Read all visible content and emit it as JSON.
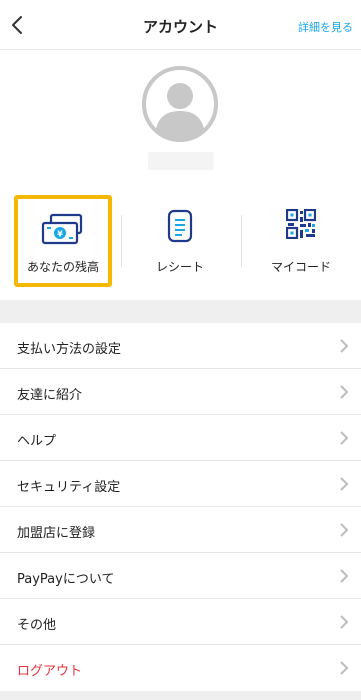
{
  "header": {
    "title": "アカウント",
    "detail_link": "詳細を見る"
  },
  "shortcuts": [
    {
      "label": "あなたの残高",
      "icon": "wallet-money-icon",
      "selected": true
    },
    {
      "label": "レシート",
      "icon": "receipt-icon"
    },
    {
      "label": "マイコード",
      "icon": "qr-code-icon"
    }
  ],
  "menu": [
    {
      "label": "支払い方法の設定"
    },
    {
      "label": "友達に紹介"
    },
    {
      "label": "ヘルプ"
    },
    {
      "label": "セキュリティ設定"
    },
    {
      "label": "加盟店に登録"
    },
    {
      "label": "PayPayについて"
    },
    {
      "label": "その他"
    },
    {
      "label": "ログアウト"
    }
  ],
  "colors": {
    "accent_link": "#1aa7e8",
    "highlight_border": "#f5b800",
    "logout_red": "#e8323c",
    "icon_navy": "#1f3a8a",
    "background_gray": "#efefef"
  }
}
